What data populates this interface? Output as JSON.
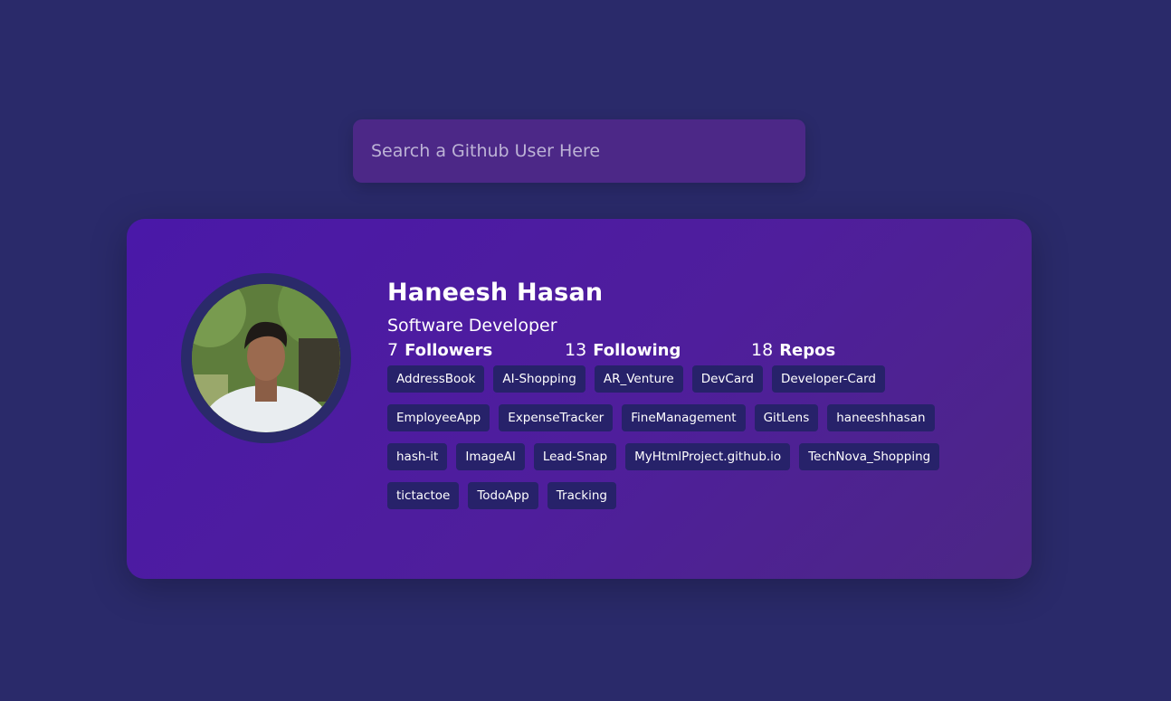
{
  "search": {
    "placeholder": "Search a Github User Here",
    "value": ""
  },
  "profile": {
    "name": "Haneesh Hasan",
    "bio": "Software Developer",
    "avatar_icon": "user-photo"
  },
  "stats": {
    "followers": {
      "count": "7",
      "label": "Followers"
    },
    "following": {
      "count": "13",
      "label": "Following"
    },
    "repos": {
      "count": "18",
      "label": "Repos"
    }
  },
  "repos": [
    "AddressBook",
    "AI-Shopping",
    "AR_Venture",
    "DevCard",
    "Developer-Card",
    "EmployeeApp",
    "ExpenseTracker",
    "FineManagement",
    "GitLens",
    "haneeshhasan",
    "hash-it",
    "ImageAI",
    "Lead-Snap",
    "MyHtmlProject.github.io",
    "TechNova_Shopping",
    "tictactoe",
    "TodoApp",
    "Tracking"
  ],
  "colors": {
    "background": "#2a2a6a",
    "search_bg": "#4c2887",
    "card_bg": "#4a18a8",
    "repo_chip": "#27226a"
  }
}
